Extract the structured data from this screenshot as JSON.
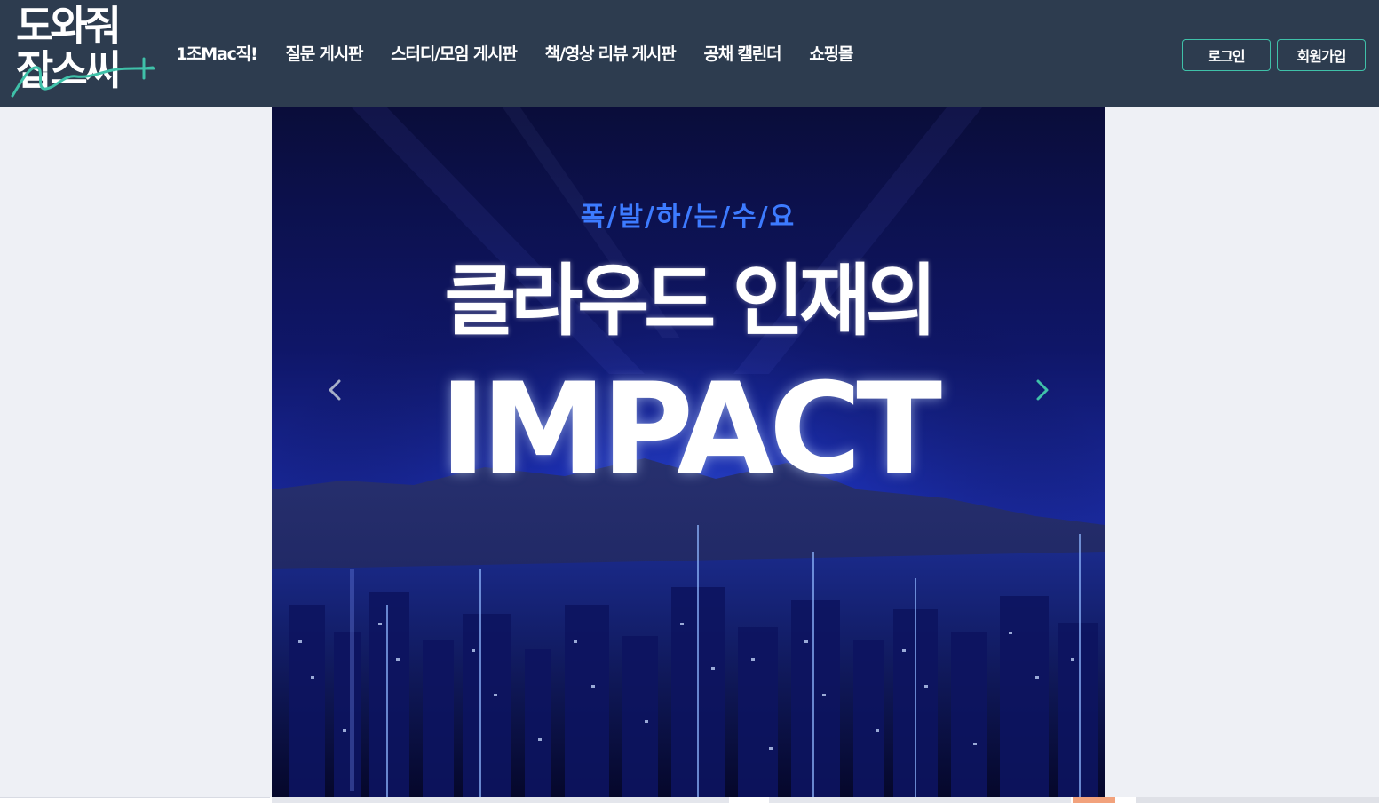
{
  "logo": {
    "line1": "도와줘",
    "line2": "잡스씨"
  },
  "nav": {
    "items": [
      {
        "label": "1조Mac직!"
      },
      {
        "label": "질문 게시판"
      },
      {
        "label": "스터디/모임 게시판"
      },
      {
        "label": "책/영상 리뷰 게시판"
      },
      {
        "label": "공채 캘린더"
      },
      {
        "label": "쇼핑몰"
      }
    ]
  },
  "auth": {
    "login_label": "로그인",
    "signup_label": "회원가입"
  },
  "banner": {
    "subtitle": "폭/발/하/는/수/요",
    "title": "클라우드 인재의",
    "headline": "IMPACT",
    "arrow_prev_icon": "chevron-left-icon",
    "arrow_next_icon": "chevron-right-icon"
  },
  "colors": {
    "header_bg": "#2d3c4f",
    "accent": "#3fc1a9",
    "page_bg": "#eef0f5",
    "banner_subtitle": "#3d7bff"
  }
}
